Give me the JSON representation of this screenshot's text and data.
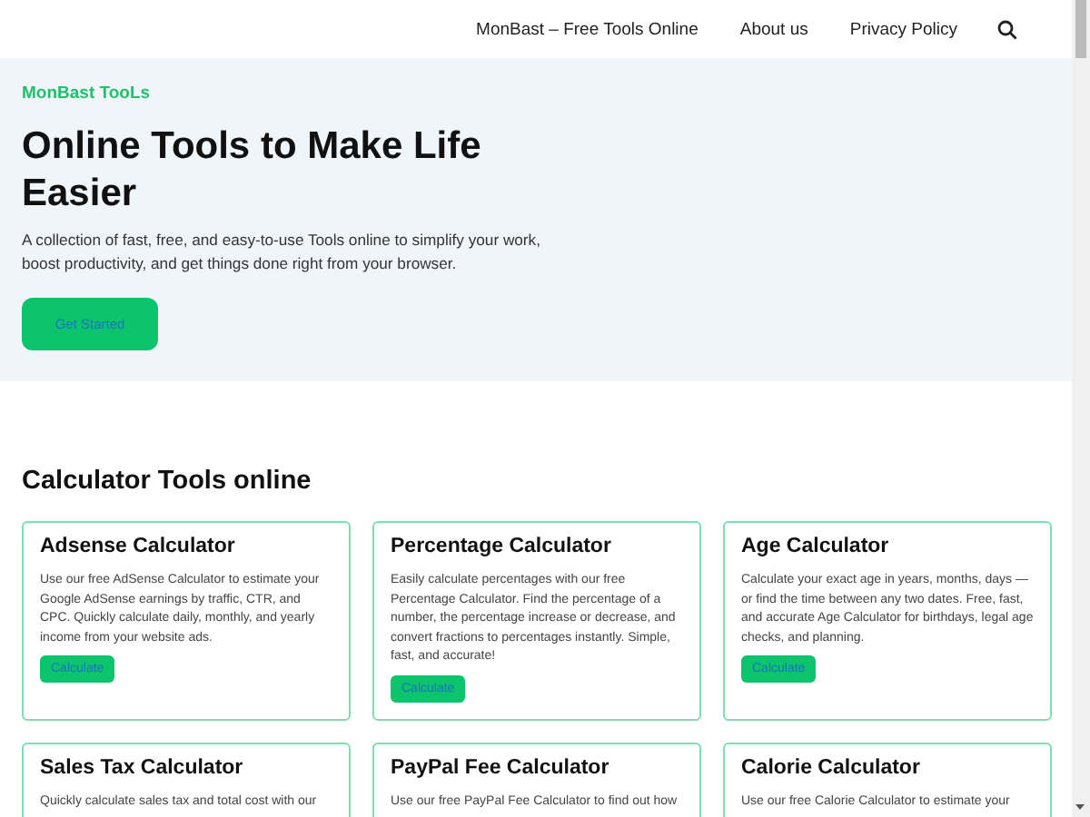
{
  "nav": {
    "items": [
      {
        "label": "MonBast – Free Tools Online"
      },
      {
        "label": "About us"
      },
      {
        "label": "Privacy Policy"
      }
    ]
  },
  "hero": {
    "eyebrow": "MonBast TooLs",
    "title": "Online Tools to Make Life Easier",
    "description": "A collection of fast, free, and easy-to-use Tools online to simplify your work, boost productivity, and get things done right from your browser.",
    "button": "Get Started"
  },
  "section": {
    "title": "Calculator Tools online"
  },
  "cards": [
    {
      "title": "Adsense Calculator",
      "description": "Use our free AdSense Calculator to estimate your Google AdSense earnings by traffic, CTR, and CPC. Quickly calculate daily, monthly, and yearly income from your website ads.",
      "button": "Calculate"
    },
    {
      "title": "Percentage Calculator",
      "description": "Easily calculate percentages with our free Percentage Calculator. Find the percentage of a number, the percentage increase or decrease, and convert fractions to percentages instantly. Simple, fast, and accurate!",
      "button": "Calculate"
    },
    {
      "title": "Age Calculator",
      "description": "Calculate your exact age in years, months, days — or find the time between any two dates. Free, fast, and accurate Age Calculator for birthdays, legal age checks, and planning.",
      "button": "Calculate"
    },
    {
      "title": "Sales Tax Calculator",
      "description": "Quickly calculate sales tax and total cost with our"
    },
    {
      "title": "PayPal Fee Calculator",
      "description": "Use our free PayPal Fee Calculator to find out how"
    },
    {
      "title": "Calorie Calculator",
      "description": "Use our free Calorie Calculator to estimate your"
    }
  ]
}
